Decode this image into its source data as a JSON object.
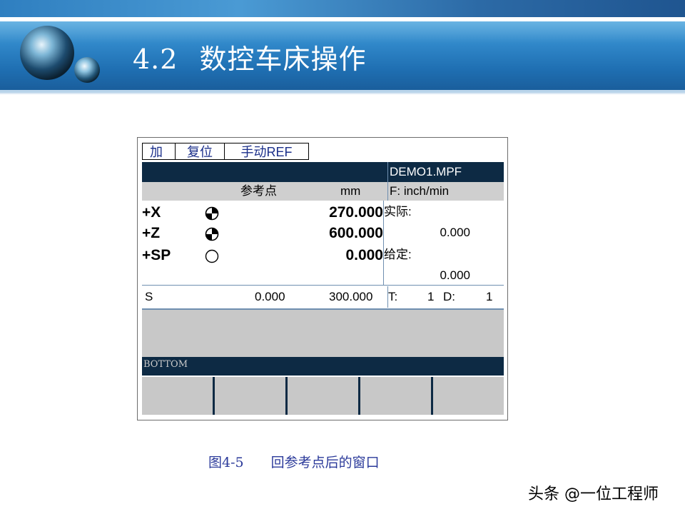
{
  "slide": {
    "title_num": "4.2",
    "title_text": "数控车床操作",
    "colors": {
      "header_blue": "#2f86c8",
      "caption_blue": "#2b3a9a",
      "cnc_dark": "#0d2a44",
      "cnc_grey": "#c8c8c8"
    }
  },
  "cnc": {
    "tabs": [
      "加工",
      "复位",
      "手动REF"
    ],
    "program": "DEMO1.MPF",
    "col_ref": "参考点",
    "col_mm": "mm",
    "feed_unit": "F: inch/min",
    "axes": [
      {
        "name": "+X",
        "icon": "referenced-icon",
        "value": "270.000"
      },
      {
        "name": "+Z",
        "icon": "referenced-icon",
        "value": "600.000"
      },
      {
        "name": "+SP",
        "icon": "not-referenced-icon",
        "value": "0.000"
      }
    ],
    "actual_label": "实际:",
    "actual_value": "0.000",
    "set_label": "给定:",
    "set_value": "0.000",
    "spindle": {
      "label": "S",
      "actual": "0.000",
      "set": "300.000",
      "t_label": "T:",
      "t_value": "1",
      "d_label": "D:",
      "d_value": "1"
    },
    "status_text": "BOTTOM",
    "softkey_count": 5
  },
  "caption": {
    "fig_no": "图4-5",
    "text": "回参考点后的窗口"
  },
  "footer": {
    "credit": "头条 @一位工程师"
  }
}
